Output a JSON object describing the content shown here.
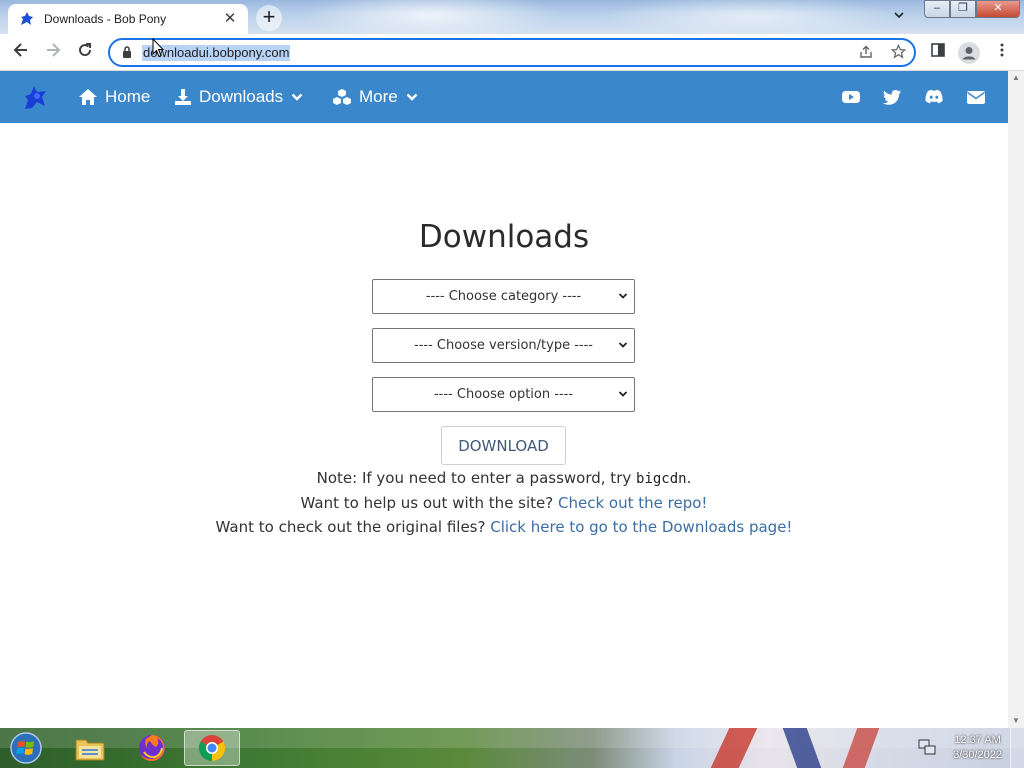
{
  "browser": {
    "tab_title": "Downloads - Bob Pony",
    "tab_close": "✕",
    "new_tab": "+",
    "url": "downloadui.bobpony.com"
  },
  "site_nav": {
    "home": "Home",
    "downloads": "Downloads",
    "more": "More",
    "color": "#3a87cc"
  },
  "main": {
    "title": "Downloads",
    "select_category": "---- Choose category ----",
    "select_version": "---- Choose version/type ----",
    "select_option": "---- Choose option ----",
    "download_button": "DOWNLOAD",
    "note_prefix": "Note: If you need to enter a password, try ",
    "note_code": "bigcdn",
    "note_suffix": ".",
    "help_prefix": "Want to help us out with the site? ",
    "help_link": "Check out the repo!",
    "orig_prefix": "Want to check out the original files? ",
    "orig_link": "Click here to go to the Downloads page!"
  },
  "taskbar": {
    "time": "12:37 AM",
    "date": "3/30/2022"
  }
}
